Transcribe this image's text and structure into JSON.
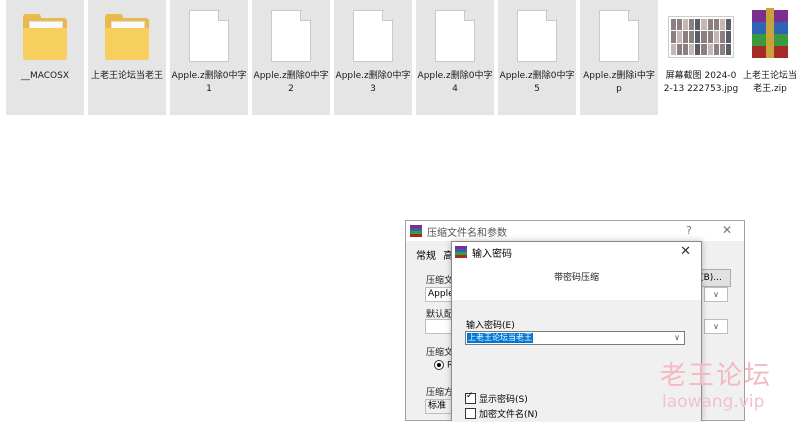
{
  "files": [
    {
      "type": "folder",
      "name": "__MACOSX",
      "selected": true
    },
    {
      "type": "folder",
      "name": "上老王论坛当老王",
      "selected": true
    },
    {
      "type": "doc",
      "name": "Apple.z删除0中字1",
      "selected": true
    },
    {
      "type": "doc",
      "name": "Apple.z删除0中字2",
      "selected": true
    },
    {
      "type": "doc",
      "name": "Apple.z删除0中字3",
      "selected": true
    },
    {
      "type": "doc",
      "name": "Apple.z删除0中字4",
      "selected": true
    },
    {
      "type": "doc",
      "name": "Apple.z删除0中字5",
      "selected": true
    },
    {
      "type": "doc",
      "name": "Apple.z删除i中字p",
      "selected": true
    },
    {
      "type": "jpg",
      "name": "屏幕截图 2024-02-13 222753.jpg",
      "selected": false
    },
    {
      "type": "zip",
      "name": "上老王论坛当老王.zip",
      "selected": false
    }
  ],
  "archive_dialog": {
    "title": "压缩文件名和参数",
    "help": "?",
    "close": "✕",
    "tabs": "常规",
    "tab2": "高",
    "archive_name_label": "压缩文件",
    "archive_name_value": "Apple",
    "browse_button": "(B)...",
    "profile_label": "默认配置",
    "format_label": "压缩文",
    "format_value": "RA",
    "method_label": "压缩方",
    "method_value": "标准",
    "chevron": "∨"
  },
  "password_dialog": {
    "title": "输入密码",
    "close": "✕",
    "subtitle": "带密码压缩",
    "label": "输入密码(E)",
    "value": "上老王论坛当老王",
    "dropdown": "∨",
    "show_password": "显示密码(S)",
    "show_password_checked": true,
    "encrypt_names": "加密文件名(N)",
    "encrypt_names_checked": false
  },
  "watermark": {
    "cn": "老王论坛",
    "en": "laowang.vip"
  }
}
